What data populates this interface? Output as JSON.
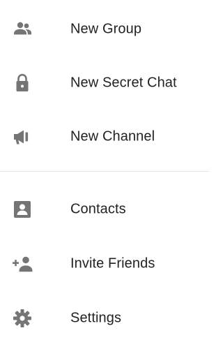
{
  "menu": {
    "items": [
      {
        "icon": "group-icon",
        "label": "New Group"
      },
      {
        "icon": "lock-icon",
        "label": "New Secret Chat"
      },
      {
        "icon": "megaphone-icon",
        "label": "New Channel"
      },
      {
        "icon": "contact-card-icon",
        "label": "Contacts"
      },
      {
        "icon": "add-person-icon",
        "label": "Invite Friends"
      },
      {
        "icon": "gear-icon",
        "label": "Settings"
      }
    ]
  },
  "colors": {
    "icon": "#757575",
    "text": "#222222",
    "divider": "#e6e6e6",
    "background": "#ffffff"
  }
}
